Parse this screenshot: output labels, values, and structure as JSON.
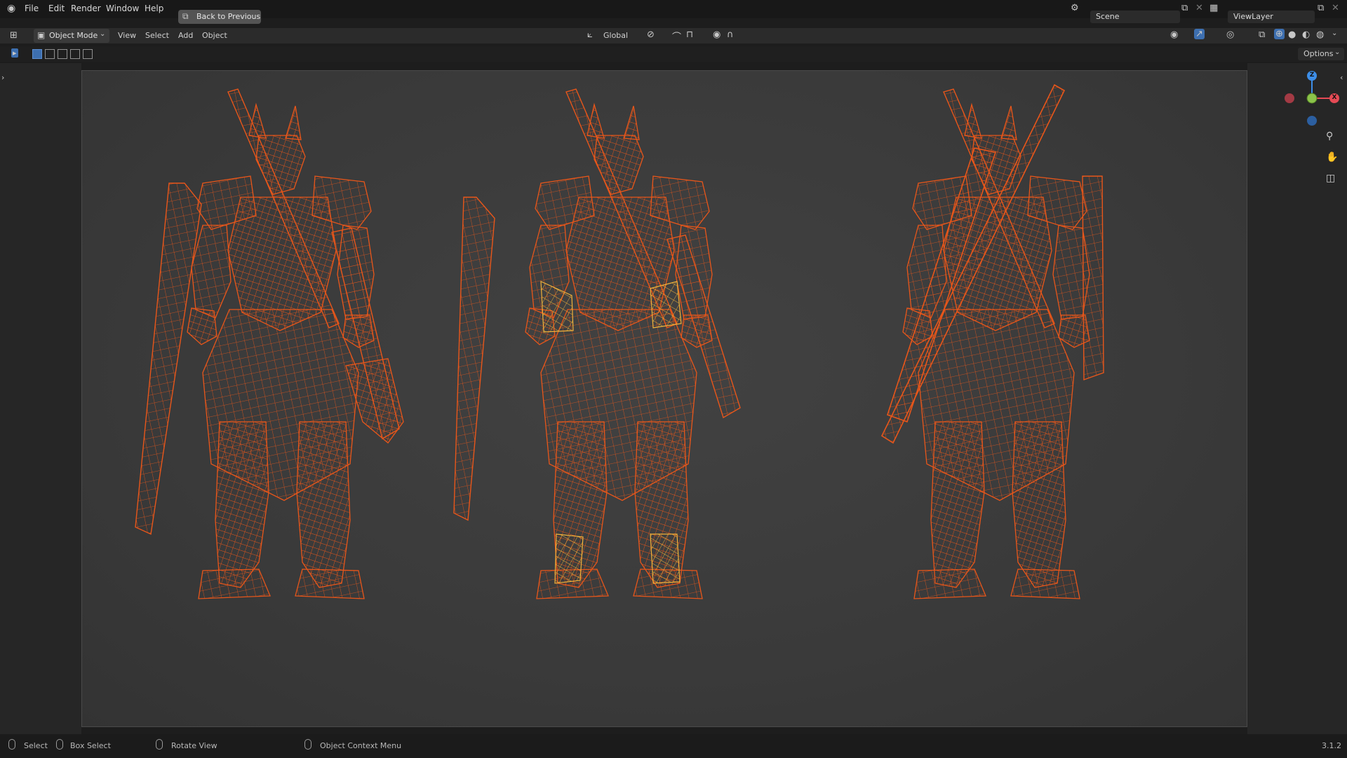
{
  "app": {
    "version": "3.1.2"
  },
  "topbar": {
    "menu": [
      "File",
      "Edit",
      "Render",
      "Window",
      "Help"
    ],
    "back_button": "Back to Previous",
    "scene_name": "Scene",
    "view_layer": "ViewLayer"
  },
  "header": {
    "mode": "Object Mode",
    "menus": [
      "View",
      "Select",
      "Add",
      "Object"
    ],
    "orientation": "Global"
  },
  "toolheader": {
    "options": "Options"
  },
  "gizmo": {
    "axes": [
      "Z",
      "X"
    ]
  },
  "statusbar": {
    "select": "Select",
    "box_select": "Box Select",
    "rotate_view": "Rotate View",
    "context_menu": "Object Context Menu"
  },
  "colors": {
    "wire": "#e8561a",
    "wire_selected": "#f2b23a",
    "axis_x": "#e54a55",
    "axis_y": "#8bc34a",
    "axis_z": "#3d8ee8"
  }
}
